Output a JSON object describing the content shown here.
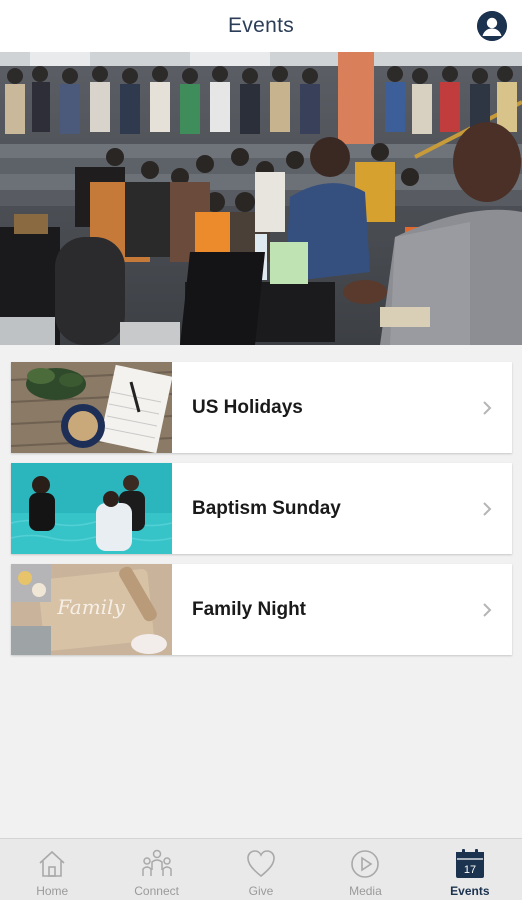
{
  "header": {
    "title": "Events"
  },
  "events": [
    {
      "title": "US Holidays"
    },
    {
      "title": "Baptism Sunday"
    },
    {
      "title": "Family Night",
      "thumb_text": "Family"
    }
  ],
  "tabs": [
    {
      "label": "Home",
      "icon": "home-icon"
    },
    {
      "label": "Connect",
      "icon": "people-icon"
    },
    {
      "label": "Give",
      "icon": "heart-icon"
    },
    {
      "label": "Media",
      "icon": "play-icon"
    },
    {
      "label": "Events",
      "icon": "calendar-icon",
      "badge": "17",
      "active": true
    }
  ],
  "colors": {
    "accent": "#1c3350",
    "inactive": "#9a9a9a",
    "background": "#f1f1f1"
  }
}
